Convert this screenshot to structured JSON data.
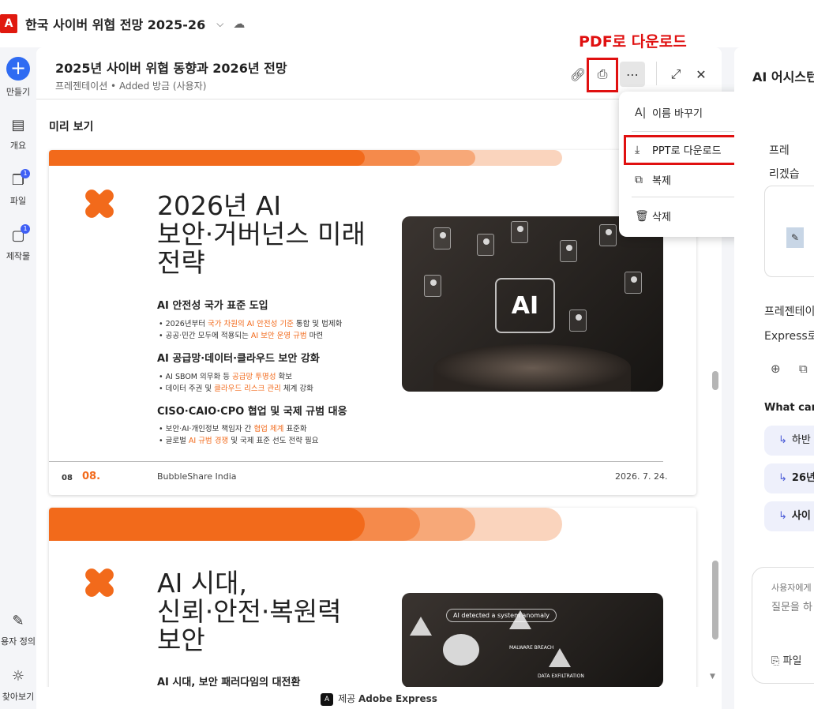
{
  "top": {
    "logo": "A",
    "title": "한국 사이버 위협 전망 2025-26",
    "chevron": "⌵",
    "cloud": "☁"
  },
  "rail": {
    "create": "만들기",
    "overview": "개요",
    "files": "파일",
    "files_badge": "1",
    "outputs": "제작물",
    "outputs_badge": "1",
    "customize": "용자 정의",
    "explore": "찾아보기"
  },
  "main": {
    "title": "2025년 사이버 위협 동향과 2026년 전망",
    "subtitle": "프레젠테이션 • Added 방금 (사용자)",
    "preview_label": "미리 보기",
    "footer_provider": "제공",
    "footer_brand": "Adobe Express"
  },
  "annotation": "PDF로 다운로드",
  "menu": {
    "rename": "이름 바꾸기",
    "download_ppt": "PPT로 다운로드",
    "duplicate": "복제",
    "delete": "삭제"
  },
  "slide1": {
    "heading_line1": "2026년 AI",
    "heading_line2": "보안·거버넌스 미래",
    "heading_line3": "전략",
    "s1_title": "AI 안전성 국가 표준 도입",
    "s1_b1_pre": "• 2026년부터 ",
    "s1_b1_hl": "국가 차원의 AI 안전성 기준",
    "s1_b1_post": " 통합 및 법제화",
    "s1_b2_pre": "• 공공·민간 모두에 적용되는 ",
    "s1_b2_hl": "AI 보안 운영 규범",
    "s1_b2_post": " 마련",
    "s2_title": "AI 공급망·데이터·클라우드 보안 강화",
    "s2_b1_pre": "• AI SBOM 의무화 등 ",
    "s2_b1_hl": "공급망 투명성",
    "s2_b1_post": " 확보",
    "s2_b2_pre": "• 데이터 주권 및 ",
    "s2_b2_hl": "클라우드 리스크 관리",
    "s2_b2_post": " 체계 강화",
    "s3_title": "CISO·CAIO·CPO 협업 및 국제 규범 대응",
    "s3_b1_pre": "• 보안·AI·개인정보 책임자 간 ",
    "s3_b1_hl": "협업 체계",
    "s3_b1_post": " 표준화",
    "s3_b2_pre": "• 글로벌 ",
    "s3_b2_hl": "AI 규범 경쟁",
    "s3_b2_post": " 및 국제 표준 선도 전략 필요",
    "image_ai": "AI",
    "page_small": "08",
    "page_big": "08.",
    "org": "BubbleShare India",
    "date": "2026. 7. 24."
  },
  "slide2": {
    "heading_line1": "AI 시대,",
    "heading_line2": "신뢰·안전·복원력",
    "heading_line3": "보안",
    "sub_peek": "AI 시대, 보안 패러다임의 대전환",
    "bubble": "AI detected a system anomaly",
    "warn1": "MALWARE BREACH",
    "warn2": "DATA EXFILTRATION"
  },
  "right": {
    "title": "AI 어시스턴트",
    "text1": "프레",
    "text2": "리겠습",
    "text3": "프레젠테이",
    "text4": "Express로",
    "what": "What can",
    "chip1": "하반",
    "chip2": "26년",
    "chip3": "사이",
    "input_ph1": "사용자에게",
    "input_ph2": "질문을 하",
    "attach": "파일"
  }
}
